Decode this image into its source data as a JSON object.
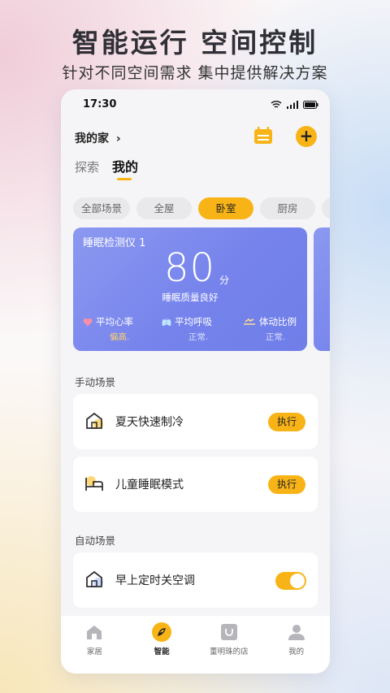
{
  "promo": {
    "headline": "智能运行 空间控制",
    "subline": "针对不同空间需求  集中提供解决方案"
  },
  "status_bar": {
    "time": "17:30"
  },
  "header": {
    "home_label": "我的家",
    "chevron": "›",
    "add_symbol": "+",
    "tabs": [
      {
        "label": "探索",
        "active": false
      },
      {
        "label": "我的",
        "active": true
      }
    ]
  },
  "rooms": [
    {
      "label": "全部场景",
      "active": false
    },
    {
      "label": "全屋",
      "active": false
    },
    {
      "label": "卧室",
      "active": true
    },
    {
      "label": "厨房",
      "active": false
    },
    {
      "label": "",
      "active": false
    }
  ],
  "sleep_monitor": {
    "title": "睡眠检测仪 1",
    "score": "80",
    "unit": "分",
    "quality": "睡眠质量良好",
    "metrics": [
      {
        "label": "平均心率",
        "value": "偏高.",
        "icon": "heart-icon"
      },
      {
        "label": "平均呼吸",
        "value": "正常.",
        "icon": "lungs-icon"
      },
      {
        "label": "体动比例",
        "value": "正常.",
        "icon": "motion-icon"
      }
    ]
  },
  "manual_scenes": {
    "title": "手动场景",
    "items": [
      {
        "name": "夏天快速制冷",
        "action": "执行",
        "icon": "house-icon"
      },
      {
        "name": "儿童睡眠模式",
        "action": "执行",
        "icon": "bed-icon"
      }
    ]
  },
  "auto_scenes": {
    "title": "自动场景",
    "items": [
      {
        "name": "早上定时关空调",
        "enabled": true,
        "icon": "house-icon"
      }
    ]
  },
  "tabbar": [
    {
      "label": "家居",
      "icon": "home-icon",
      "active": false
    },
    {
      "label": "智能",
      "icon": "smart-icon",
      "active": true
    },
    {
      "label": "董明珠的店",
      "icon": "store-icon",
      "active": false
    },
    {
      "label": "我的",
      "icon": "profile-icon",
      "active": false
    }
  ],
  "colors": {
    "accent": "#f8b417",
    "card_gradient": "#7683ec",
    "background": "#f5f5f7"
  }
}
